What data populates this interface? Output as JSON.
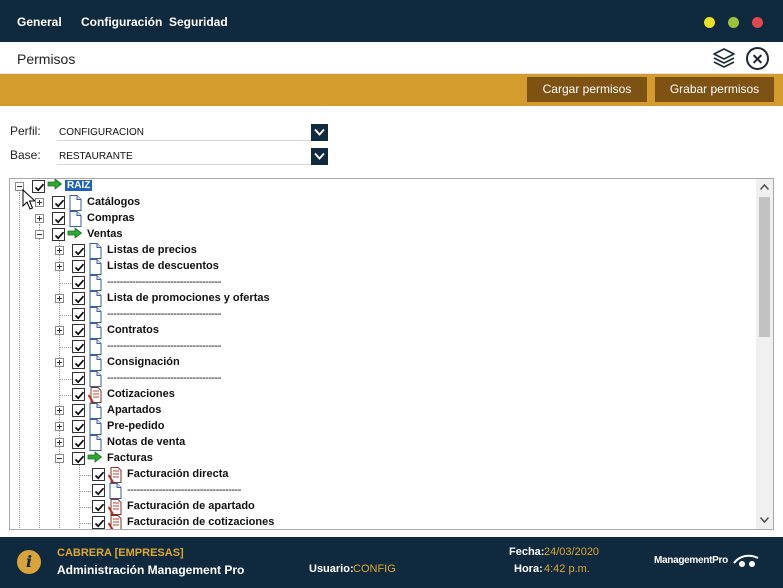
{
  "menu": {
    "general": "General",
    "configuracion": "Configuración",
    "seguridad": "Seguridad"
  },
  "window_buttons": {
    "minimize_color": "#e8e020",
    "maximize_color": "#9cc13c",
    "close_color": "#e0474f"
  },
  "page": {
    "title": "Permisos"
  },
  "toolbar": {
    "cargar": "Cargar permisos",
    "grabar": "Grabar permisos"
  },
  "form": {
    "perfil_label": "Perfil:",
    "perfil_value": "CONFIGURACION",
    "base_label": "Base:",
    "base_value": "RESTAURANTE"
  },
  "tree": {
    "root": "RAIZ",
    "catalogos": "Catálogos",
    "compras": "Compras",
    "ventas": "Ventas",
    "listas_precios": "Listas de precios",
    "listas_descuentos": "Listas de descuentos",
    "separator": "------------------------------------",
    "separator_long": "------------------------------------",
    "promociones": "Lista de promociones y ofertas",
    "contratos": "Contratos",
    "consignacion": "Consignación",
    "cotizaciones": "Cotizaciones",
    "apartados": "Apartados",
    "prepedido": "Pre-pedido",
    "notas_venta": "Notas de venta",
    "facturas": "Facturas",
    "facturacion_directa": "Facturación directa",
    "facturacion_apartado": "Facturación de apartado",
    "facturacion_cotizaciones": "Facturación de cotizaciones"
  },
  "footer": {
    "company": "CABRERA [EMPRESAS]",
    "app": "Administración Management Pro",
    "usuario_label": "Usuario:",
    "usuario_value": "CONFIG",
    "fecha_label": "Fecha:",
    "fecha_value": "24/03/2020",
    "hora_label": "Hora:",
    "hora_value": "4:42 p.m.",
    "brand": "ManagementPro"
  },
  "colors": {
    "nav": "#0f2a3f",
    "accent": "#d39c2d",
    "button": "#7d5212",
    "selection": "#1e63b8"
  }
}
